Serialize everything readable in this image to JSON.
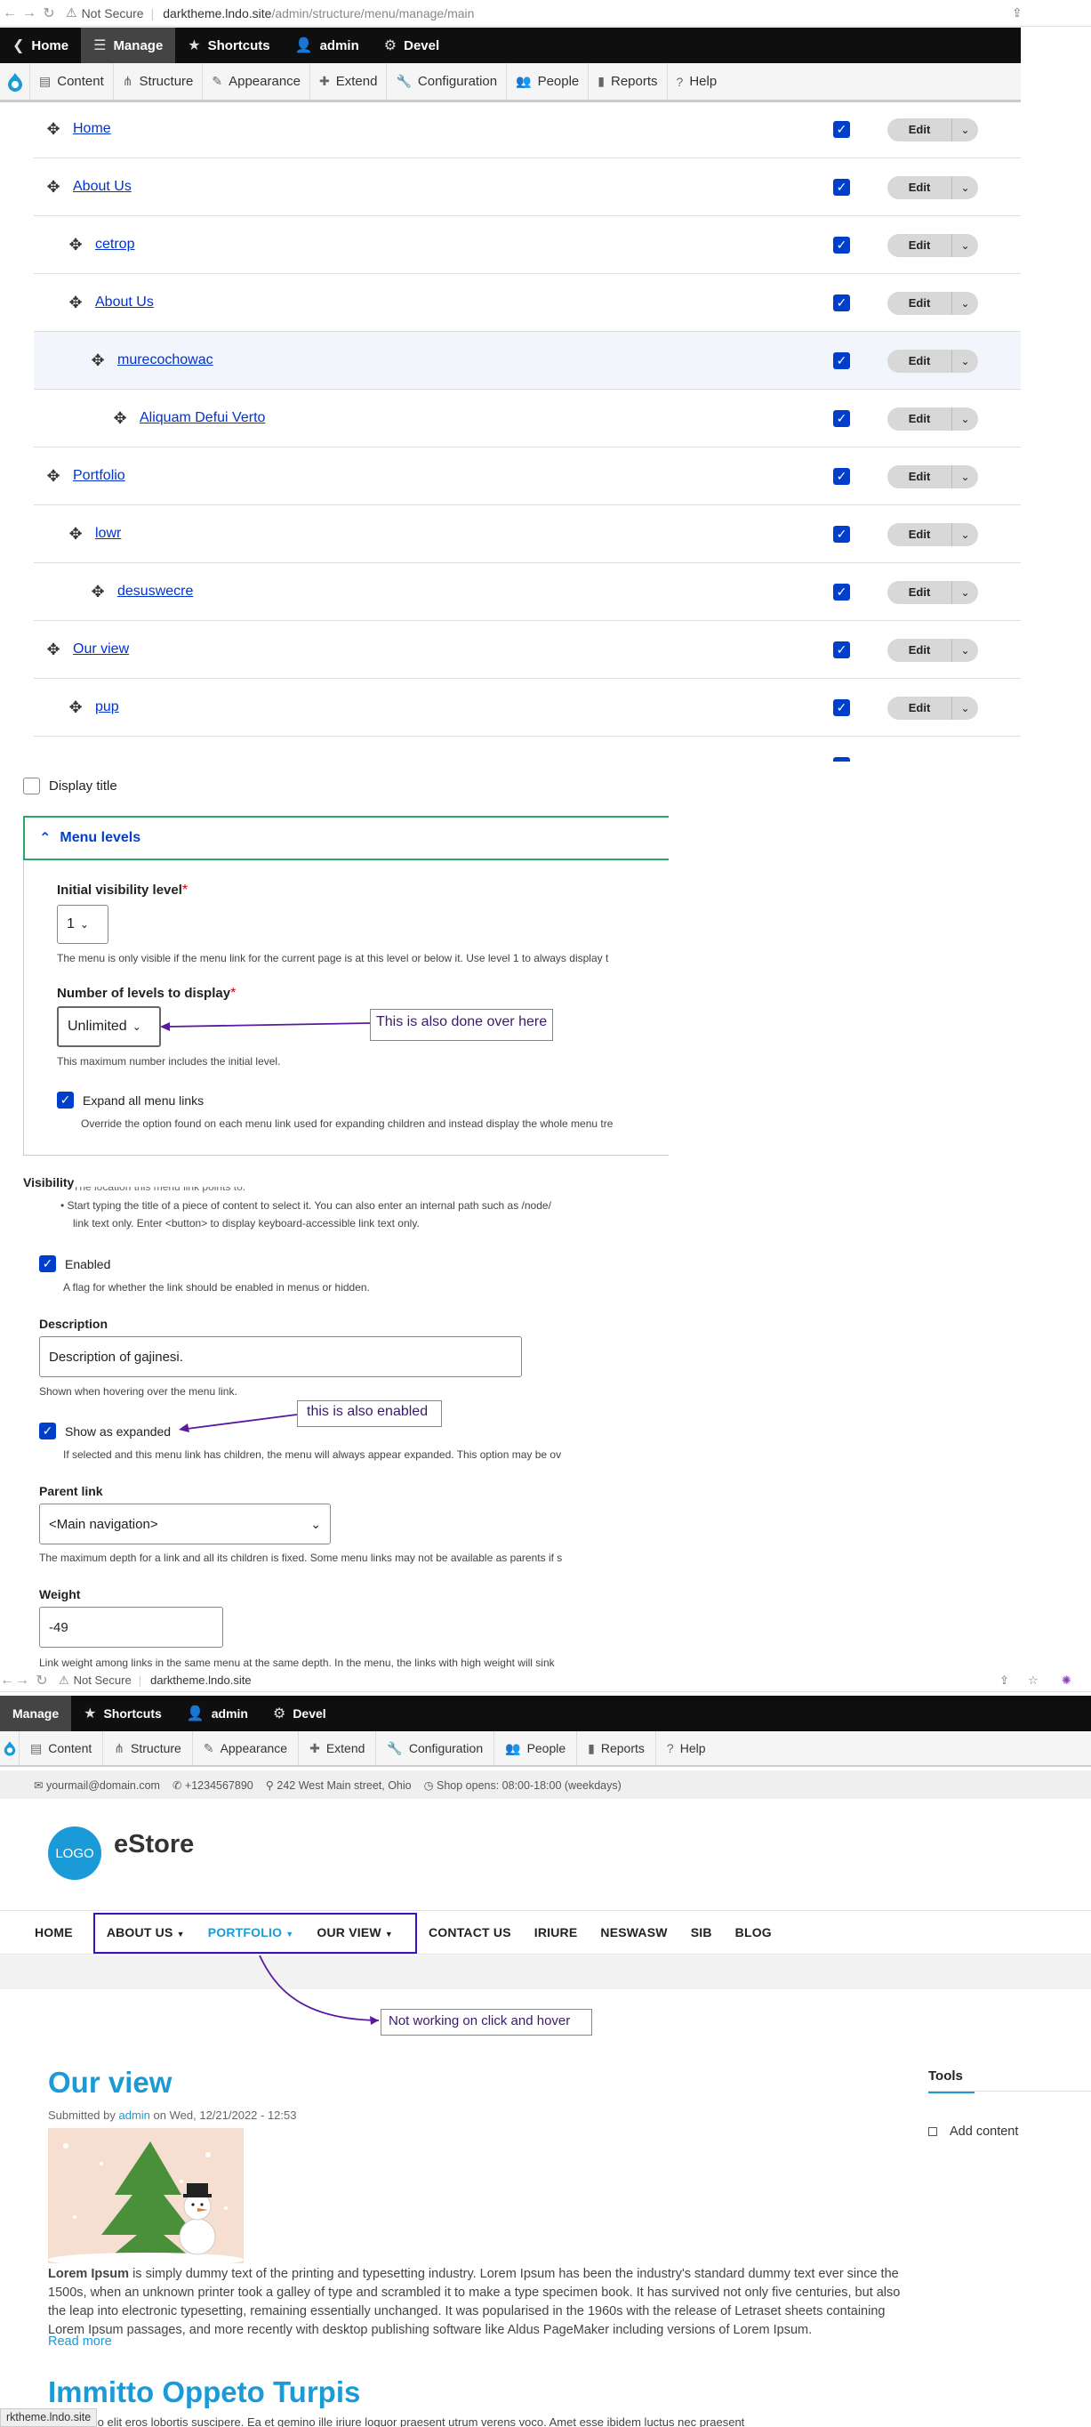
{
  "browser1": {
    "security": "Not Secure",
    "url_host": "darktheme.lndo.site",
    "url_path": "/admin/structure/menu/manage/main"
  },
  "toolbar1": {
    "items": [
      "Home",
      "Manage",
      "Shortcuts",
      "admin",
      "Devel"
    ]
  },
  "tray1": {
    "items": [
      "Content",
      "Structure",
      "Appearance",
      "Extend",
      "Configuration",
      "People",
      "Reports",
      "Help"
    ]
  },
  "menu_table": {
    "rows": [
      {
        "label": "Home",
        "level": 0
      },
      {
        "label": "About Us",
        "level": 0
      },
      {
        "label": "cetrop",
        "level": 1
      },
      {
        "label": "About Us",
        "level": 1
      },
      {
        "label": "murecochowac",
        "level": 2
      },
      {
        "label": "Aliquam Defui Verto",
        "level": 3
      },
      {
        "label": "Portfolio",
        "level": 0
      },
      {
        "label": "lowr",
        "level": 1
      },
      {
        "label": "desuswecre",
        "level": 2
      },
      {
        "label": "Our view",
        "level": 0
      },
      {
        "label": "pup",
        "level": 1
      }
    ],
    "edit_label": "Edit"
  },
  "block_form": {
    "display_title": "Display title",
    "menu_levels_title": "Menu levels",
    "initial_visibility_label": "Initial visibility level",
    "initial_visibility_value": "1",
    "initial_visibility_help": "The menu is only visible if the menu link for the current page is at this level or below it. Use level 1 to always display t",
    "levels_label": "Number of levels to display",
    "levels_value": "Unlimited",
    "levels_help": "This maximum number includes the initial level.",
    "expand_label": "Expand all menu links",
    "expand_help": "Override the option found on each menu link used for expanding children and instead display the whole menu tre",
    "callout": "This is also done over here",
    "required_mark": "*"
  },
  "link_form": {
    "visibility": "Visibility",
    "cut_text": "The location this menu link points to.",
    "bullet_1": "Start typing the title of a piece of content to select it. You can also enter an internal path such as /node/",
    "bullet_2": "link text only. Enter <button> to display keyboard-accessible link text only.",
    "enabled_label": "Enabled",
    "enabled_help": "A flag for whether the link should be enabled in menus or hidden.",
    "description_label": "Description",
    "description_value": "Description of gajinesi.",
    "description_help": "Shown when hovering over the menu link.",
    "expanded_label": "Show as expanded",
    "expanded_help": "If selected and this menu link has children, the menu will always appear expanded. This option may be ov",
    "callout": "this is also enabled",
    "parent_label": "Parent link",
    "parent_value": "<Main navigation>",
    "parent_help": "The maximum depth for a link and all its children is fixed. Some menu links may not be available as parents if s",
    "weight_label": "Weight",
    "weight_value": "-49",
    "weight_help": "Link weight among links in the same menu at the same depth. In the menu, the links with high weight will sink"
  },
  "browser2": {
    "security": "Not Secure",
    "url_host": "darktheme.lndo.site"
  },
  "toolbar2": {
    "items": [
      "Manage",
      "Shortcuts",
      "admin",
      "Devel"
    ]
  },
  "tray2": {
    "items": [
      "Content",
      "Structure",
      "Appearance",
      "Extend",
      "Configuration",
      "People",
      "Reports",
      "Help"
    ]
  },
  "site": {
    "email": "yourmail@domain.com",
    "phone": "+1234567890",
    "address": "242 West Main street, Ohio",
    "hours": "Shop opens: 08:00-18:00 (weekdays)",
    "logo": "LOGO",
    "name": "eStore",
    "nav": [
      "HOME",
      "ABOUT US",
      "PORTFOLIO",
      "OUR VIEW",
      "CONTACT US",
      "IRIURE",
      "NESWASW",
      "SIB",
      "BLOG"
    ],
    "callout": "Not working on click and hover",
    "article_title": "Our view",
    "submitted_prefix": "Submitted by",
    "author": "admin",
    "submitted_date": "on Wed, 12/21/2022 - 12:53",
    "body_bold": "Lorem Ipsum",
    "body": " is simply dummy text of the printing and typesetting industry. Lorem Ipsum has been the industry's standard dummy text ever since the 1500s, when an unknown printer took a galley of type and scrambled it to make a type specimen book. It has survived not only five centuries, but also the leap into electronic typesetting, remaining essentially unchanged. It was popularised in the 1960s with the release of Letraset sheets containing Lorem Ipsum passages, and more recently with desktop publishing software like Aldus PageMaker including versions of Lorem Ipsum.",
    "read_more": "Read more",
    "article2_title": "Immitto Oppeto Turpis",
    "article2_snippet": "do distineo elit eros lobortis suscipere. Ea et gemino ille iriure loquor praesent utrum verens voco. Amet esse ibidem luctus nec praesent",
    "sidebar_title": "Tools",
    "sidebar_item": "Add content",
    "status_url": "rktheme.lndo.site"
  },
  "colors": {
    "accent": "#1a9bd7",
    "admin_blue": "#003ecc",
    "callout_purple": "#5a1aa0",
    "menu_levels_border": "#26a769"
  }
}
